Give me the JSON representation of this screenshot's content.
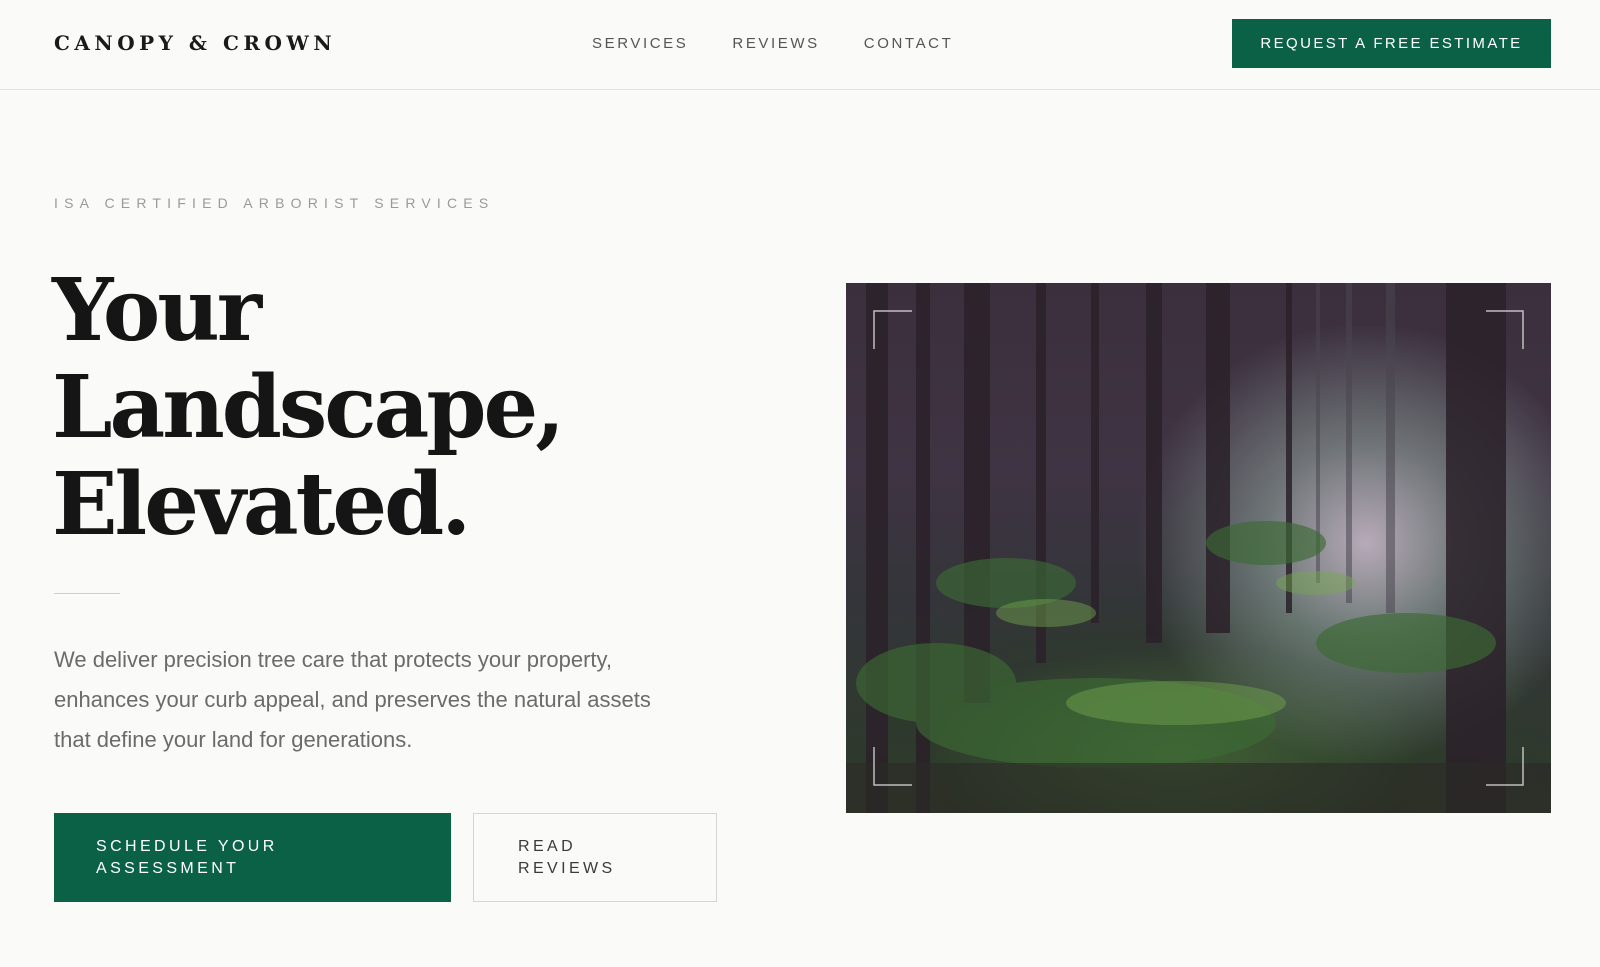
{
  "header": {
    "logo": "CANOPY & CROWN",
    "nav": [
      {
        "label": "SERVICES"
      },
      {
        "label": "REVIEWS"
      },
      {
        "label": "CONTACT"
      }
    ],
    "cta_label": "REQUEST A FREE ESTIMATE"
  },
  "hero": {
    "eyebrow": "ISA CERTIFIED ARBORIST SERVICES",
    "headline": [
      "Your",
      "Landscape,",
      "Elevated."
    ],
    "description": "We deliver precision tree care that protects your property, enhances your curb appeal, and preserves the natural assets that define your land for generations.",
    "primary_button": [
      "SCHEDULE YOUR",
      "ASSESSMENT"
    ],
    "secondary_button": [
      "READ",
      "REVIEWS"
    ],
    "image": "forest-photo"
  },
  "colors": {
    "accent": "#0b6146",
    "background": "#fafaf8",
    "text": "#1a1a1a"
  }
}
